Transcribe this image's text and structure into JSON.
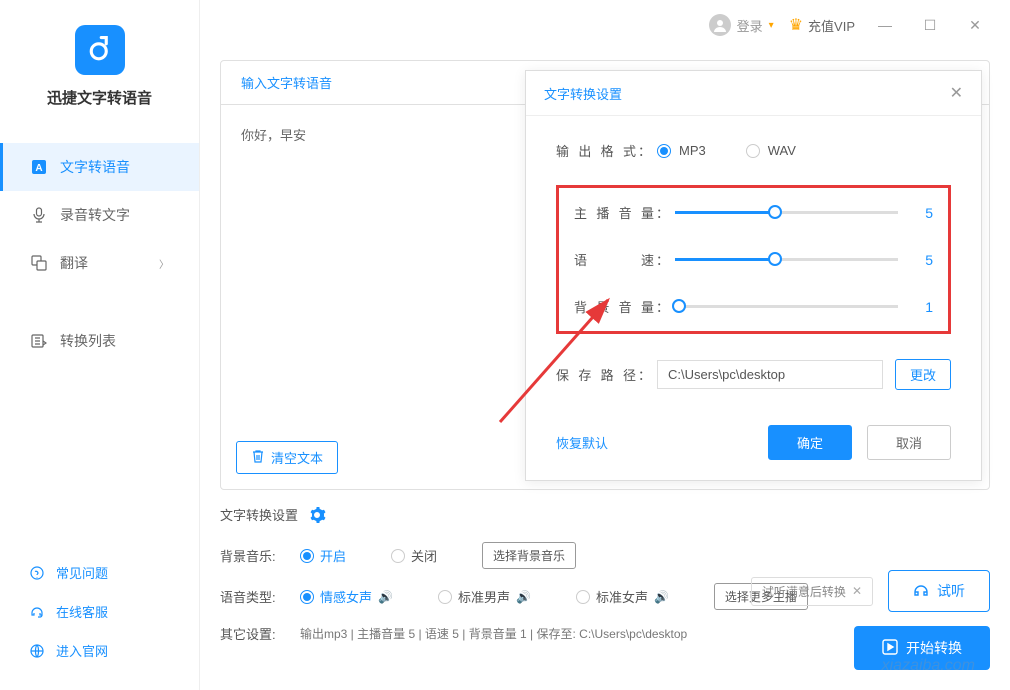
{
  "app": {
    "name": "迅捷文字转语音"
  },
  "topbar": {
    "login": "登录",
    "vip": "充值VIP"
  },
  "nav": {
    "items": [
      {
        "label": "文字转语音",
        "active": true
      },
      {
        "label": "录音转文字",
        "active": false
      },
      {
        "label": "翻译",
        "active": false,
        "chevron": true
      },
      {
        "label": "转换列表",
        "active": false
      }
    ]
  },
  "sidebar_links": {
    "faq": "常见问题",
    "service": "在线客服",
    "website": "进入官网"
  },
  "content": {
    "tab1": "输入文字转语音",
    "sample_text": "你好，早安",
    "clear": "清空文本"
  },
  "dialog": {
    "title": "文字转换设置",
    "format_label": "输出格式",
    "format_opts": [
      "MP3",
      "WAV"
    ],
    "volume_label": "主播音量",
    "volume_value": "5",
    "speed_label": "语　　速",
    "speed_value": "5",
    "bg_volume_label": "背景音量",
    "bg_volume_value": "1",
    "path_label": "保存路径",
    "path_value": "C:\\Users\\pc\\desktop",
    "change": "更改",
    "restore": "恢复默认",
    "ok": "确定",
    "cancel": "取消"
  },
  "bottom": {
    "header": "文字转换设置",
    "bg_music_label": "背景音乐:",
    "bg_on": "开启",
    "bg_off": "关闭",
    "select_music": "选择背景音乐",
    "voice_type_label": "语音类型:",
    "voice_opts": [
      "情感女声",
      "标准男声",
      "标准女声"
    ],
    "more_voices": "选择更多主播",
    "other_label": "其它设置:",
    "summary": "输出mp3 | 主播音量 5 | 语速 5 | 背景音量 1 | 保存至: C:\\Users\\pc\\desktop",
    "preview_tag": "试听满意后转换",
    "listen": "试听",
    "convert": "开始转换"
  },
  "watermark": "xiazaiba.com"
}
